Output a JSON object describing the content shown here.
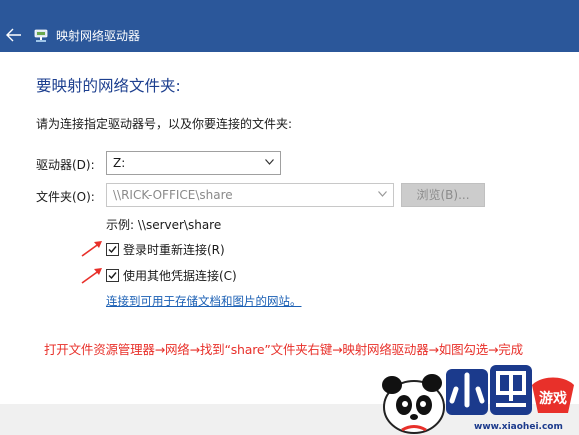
{
  "window": {
    "title": "映射网络驱动器",
    "titlebar_color": "#2b579a"
  },
  "content": {
    "heading": "要映射的网络文件夹:",
    "instruction": "请为连接指定驱动器号，以及你要连接的文件夹:",
    "drive": {
      "label": "驱动器(D):",
      "value": "Z:"
    },
    "folder": {
      "label": "文件夹(O):",
      "value": "\\\\RICK-OFFICE\\share"
    },
    "browse_label": "浏览(B)...",
    "example": "示例: \\\\server\\share",
    "reconnect": {
      "label": "登录时重新连接(R)",
      "checked": true
    },
    "other_credentials": {
      "label": "使用其他凭据连接(C)",
      "checked": true
    },
    "website_link": "连接到可用于存储文档和图片的网站。"
  },
  "annotation": {
    "steps": "打开文件资源管理器→网络→找到“share”文件夹右键→映射网络驱动器→如图勾选→完成",
    "color": "#e8302a"
  },
  "watermark": {
    "logo_text": "小黑游戏",
    "url": "www.xiaohei.com"
  },
  "icons": {
    "back": "back-arrow-icon",
    "app": "network-drive-icon",
    "dropdown": "chevron-down-icon"
  }
}
